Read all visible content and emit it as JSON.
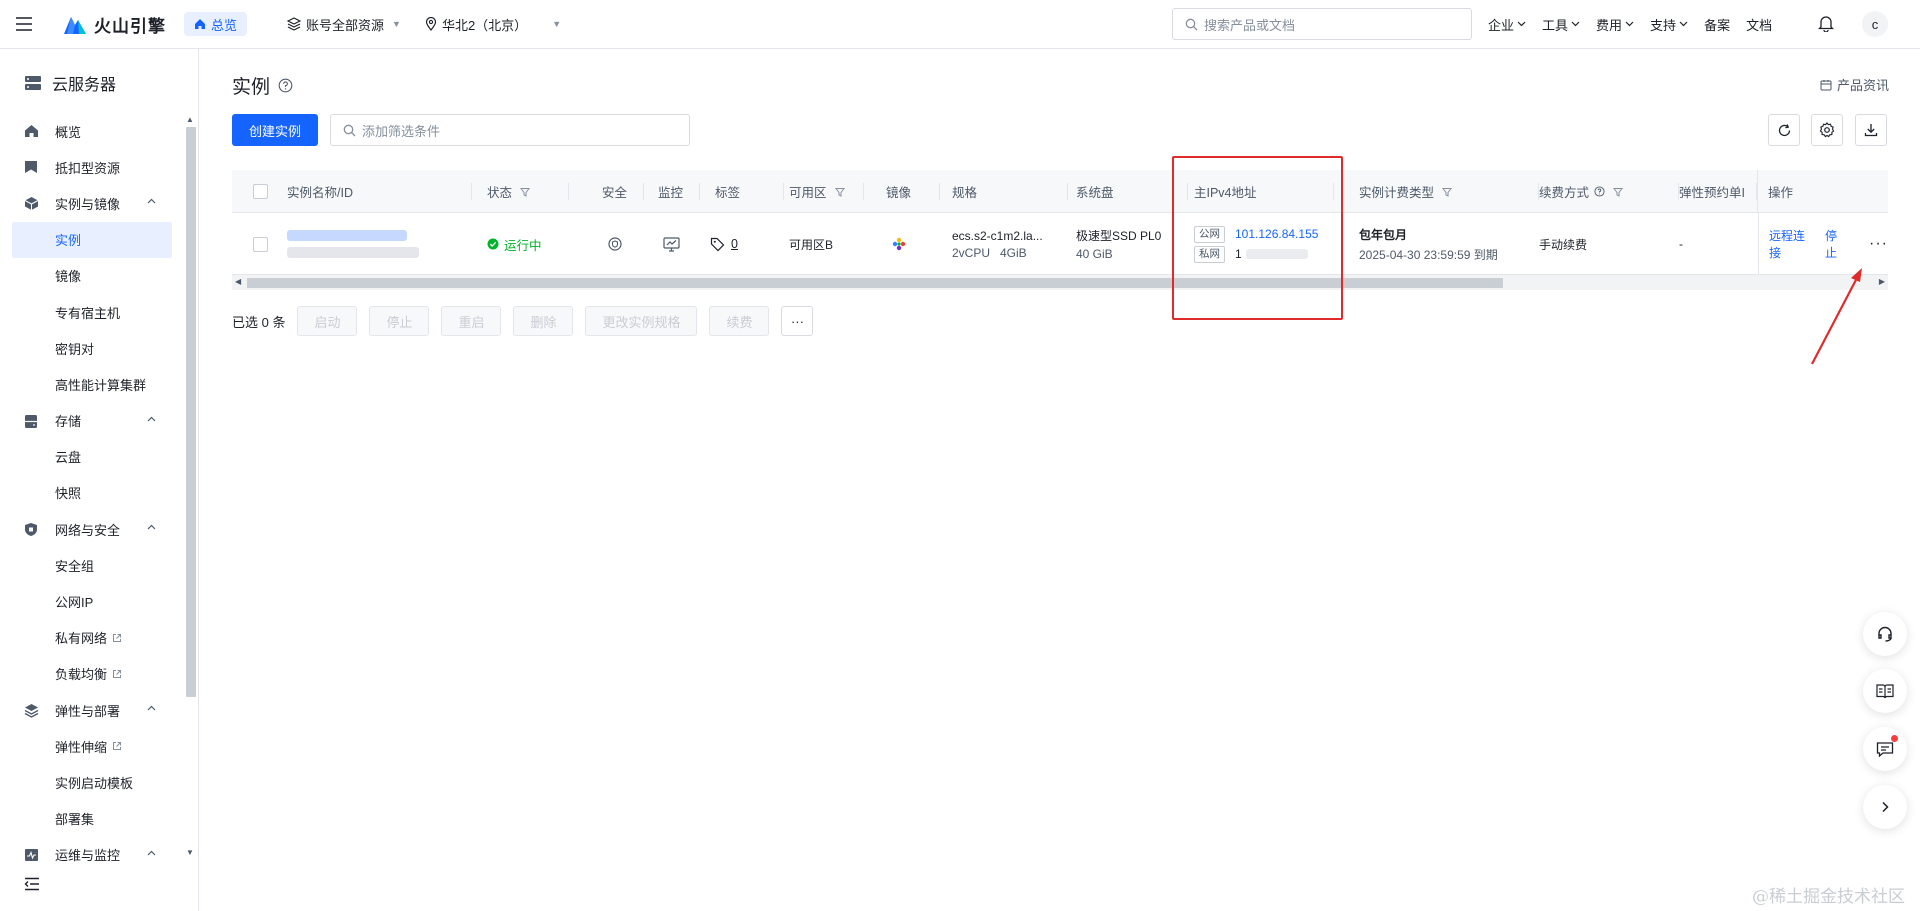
{
  "topbar": {
    "logo_text": "火山引擎",
    "home_label": "总览",
    "account_scope": "账号全部资源",
    "region": "华北2（北京）",
    "search_placeholder": "搜索产品或文档",
    "menu": [
      {
        "label": "企业",
        "has_dropdown": true
      },
      {
        "label": "工具",
        "has_dropdown": true
      },
      {
        "label": "费用",
        "has_dropdown": true
      },
      {
        "label": "支持",
        "has_dropdown": true
      },
      {
        "label": "备案",
        "has_dropdown": false
      },
      {
        "label": "文档",
        "has_dropdown": false
      }
    ],
    "avatar_letter": "c"
  },
  "sidebar": {
    "title": "云服务器",
    "items": [
      {
        "type": "group",
        "label": "概览",
        "icon": "home-icon"
      },
      {
        "type": "group",
        "label": "抵扣型资源",
        "icon": "bookmark-icon"
      },
      {
        "type": "group",
        "label": "实例与镜像",
        "icon": "cube-icon",
        "expanded": true
      },
      {
        "type": "child",
        "label": "实例",
        "active": true
      },
      {
        "type": "child",
        "label": "镜像"
      },
      {
        "type": "child",
        "label": "专有宿主机"
      },
      {
        "type": "child",
        "label": "密钥对"
      },
      {
        "type": "child",
        "label": "高性能计算集群"
      },
      {
        "type": "group",
        "label": "存储",
        "icon": "storage-icon",
        "expanded": true
      },
      {
        "type": "child",
        "label": "云盘"
      },
      {
        "type": "child",
        "label": "快照"
      },
      {
        "type": "group",
        "label": "网络与安全",
        "icon": "shield-icon",
        "expanded": true
      },
      {
        "type": "child",
        "label": "安全组"
      },
      {
        "type": "child",
        "label": "公网IP"
      },
      {
        "type": "child",
        "label": "私有网络",
        "external": true
      },
      {
        "type": "child",
        "label": "负载均衡",
        "external": true
      },
      {
        "type": "group",
        "label": "弹性与部署",
        "icon": "layers-icon",
        "expanded": true
      },
      {
        "type": "child",
        "label": "弹性伸缩",
        "external": true
      },
      {
        "type": "child",
        "label": "实例启动模板"
      },
      {
        "type": "child",
        "label": "部署集"
      },
      {
        "type": "group",
        "label": "运维与监控",
        "icon": "monitor-icon",
        "expanded": true
      }
    ]
  },
  "page": {
    "title": "实例",
    "product_info": "产品资讯",
    "create_button": "创建实例",
    "filter_placeholder": "添加筛选条件"
  },
  "table": {
    "columns": [
      {
        "label": "实例名称/ID",
        "filter": false
      },
      {
        "label": "状态",
        "filter": true
      },
      {
        "label": "安全",
        "filter": false
      },
      {
        "label": "监控",
        "filter": false
      },
      {
        "label": "标签",
        "filter": false
      },
      {
        "label": "可用区",
        "filter": true
      },
      {
        "label": "镜像",
        "filter": false
      },
      {
        "label": "规格",
        "filter": false
      },
      {
        "label": "系统盘",
        "filter": false
      },
      {
        "label": "主IPv4地址",
        "filter": false
      },
      {
        "label": "实例计费类型",
        "filter": true
      },
      {
        "label": "续费方式",
        "filter": true,
        "help": true
      },
      {
        "label": "弹性预约单I",
        "filter": false
      },
      {
        "label": "操作",
        "filter": false
      }
    ],
    "rows": [
      {
        "status": "运行中",
        "tag_count": "0",
        "zone": "可用区B",
        "spec": "ecs.s2-c1m2.la...",
        "spec_detail": "2vCPU   4GiB",
        "disk": "极速型SSD PL0",
        "disk_size": "40 GiB",
        "public_badge": "公网",
        "public_ip": "101.126.84.155",
        "private_badge": "私网",
        "private_ip": "1",
        "billing": "包年包月",
        "expire": "2025-04-30 23:59:59 到期",
        "renew": "手动续费",
        "reservation": "-",
        "action_connect": "远程连接",
        "action_stop": "停止",
        "action_more": "···"
      }
    ]
  },
  "batch": {
    "selected_label": "已选 0 条",
    "buttons": [
      "启动",
      "停止",
      "重启",
      "删除",
      "更改实例规格",
      "续费"
    ],
    "more": "···"
  },
  "watermark": "@稀土掘金技术社区",
  "colors": {
    "primary": "#1664ff",
    "running": "#00b42a",
    "highlight": "#e02b2b"
  }
}
